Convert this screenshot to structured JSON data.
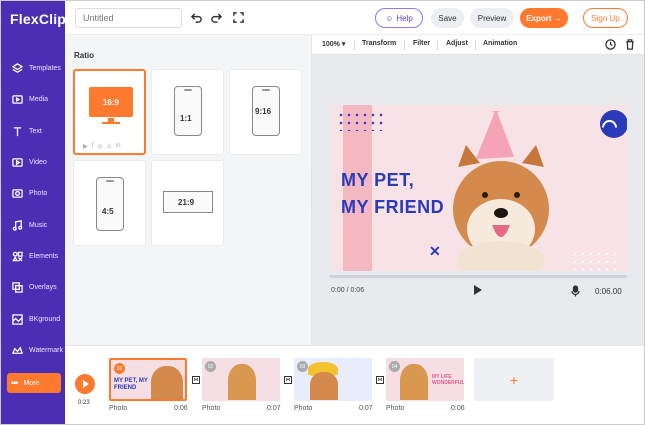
{
  "app": {
    "logo": "FlexClip"
  },
  "sidebar": {
    "items": [
      {
        "label": "Templates",
        "icon": "layers-icon"
      },
      {
        "label": "Media",
        "icon": "media-icon"
      },
      {
        "label": "Text",
        "icon": "text-icon"
      },
      {
        "label": "Video",
        "icon": "video-icon"
      },
      {
        "label": "Photo",
        "icon": "photo-icon"
      },
      {
        "label": "Music",
        "icon": "music-icon"
      },
      {
        "label": "Elements",
        "icon": "elements-icon"
      },
      {
        "label": "Overlays",
        "icon": "overlays-icon"
      },
      {
        "label": "BKground",
        "icon": "background-icon"
      },
      {
        "label": "Watermark",
        "icon": "watermark-icon"
      }
    ],
    "more_label": "More",
    "more_icon": "dots-icon"
  },
  "header": {
    "title_placeholder": "Untitled",
    "help_label": "Help",
    "save_label": "Save",
    "preview_label": "Preview",
    "export_label": "Export →",
    "signup_label": "Sign Up"
  },
  "ratio_panel": {
    "title": "Ratio",
    "options": [
      "16:9",
      "1:1",
      "9:16",
      "4:5",
      "21:9"
    ],
    "selected": "16:9"
  },
  "toolbar": {
    "zoom": "100%",
    "tools": [
      "Transform",
      "Filter",
      "Adjust",
      "Animation"
    ]
  },
  "canvas": {
    "title_line1": "MY PET,",
    "title_line2": "MY FRIEND",
    "time_current": "0:00 / 0:06",
    "time_total": "0:06.00"
  },
  "timeline": {
    "total_time": "0:23",
    "clips": [
      {
        "num": "01",
        "label": "Photo",
        "duration": "0:06",
        "caption": "MY PET, MY FRIEND"
      },
      {
        "num": "02",
        "label": "Photo",
        "duration": "0:07",
        "caption": ""
      },
      {
        "num": "03",
        "label": "Photo",
        "duration": "0:07",
        "caption": ""
      },
      {
        "num": "04",
        "label": "Photo",
        "duration": "0:06",
        "caption": "MY LIFE WONDERFUL"
      }
    ],
    "add_label": "+"
  },
  "colors": {
    "brand": "#4a2fb5",
    "accent": "#ff7a2f",
    "title_blue": "#2a3ab8"
  }
}
